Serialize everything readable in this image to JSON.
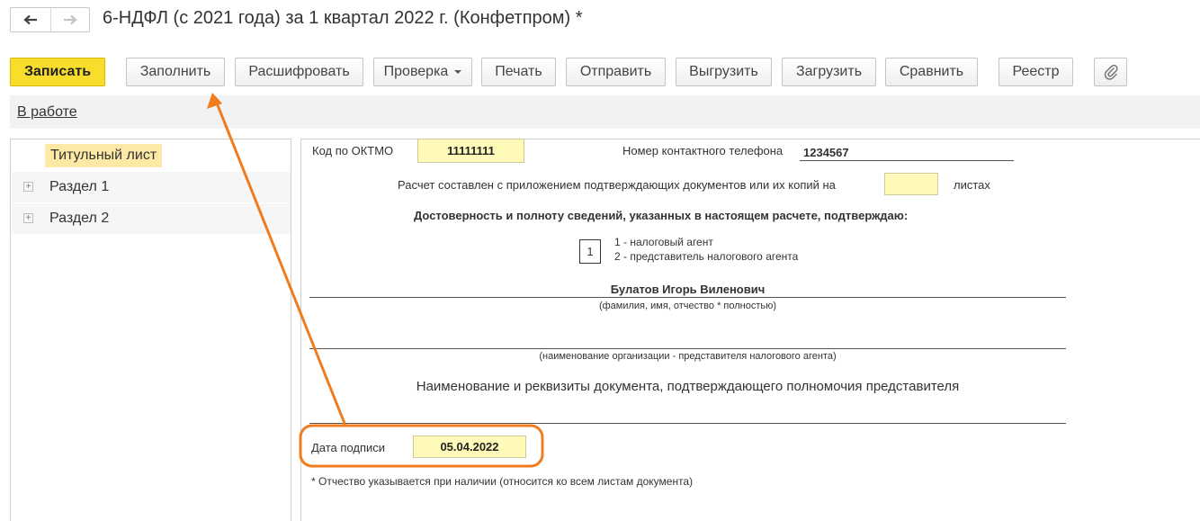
{
  "window": {
    "title": "6-НДФЛ (с 2021 года) за 1 квартал 2022 г. (Конфетпром) *"
  },
  "nav": {
    "back_icon": "arrow-left-icon",
    "forward_icon": "arrow-right-icon"
  },
  "toolbar": {
    "save": "Записать",
    "fill": "Заполнить",
    "decode": "Расшифровать",
    "check": "Проверка",
    "print": "Печать",
    "send": "Отправить",
    "export": "Выгрузить",
    "import": "Загрузить",
    "compare": "Сравнить",
    "registry": "Реестр",
    "attach_icon": "paperclip-icon"
  },
  "status": {
    "label": "В работе"
  },
  "tree": {
    "items": [
      {
        "label": "Титульный лист",
        "selected": true
      },
      {
        "label": "Раздел 1",
        "expandable": true
      },
      {
        "label": "Раздел 2",
        "expandable": true
      }
    ]
  },
  "form": {
    "oktmo_label": "Код по ОКТМО",
    "oktmo_value": "11111111",
    "phone_label": "Номер контактного телефона",
    "phone_value": "1234567",
    "attached_prefix": "Расчет составлен с приложением подтверждающих документов или их копий на",
    "attached_value": "",
    "attached_suffix": "листах",
    "confirm_heading": "Достоверность и полноту сведений, указанных в настоящем расчете, подтверждаю:",
    "signer_code": "1",
    "signer_option_1": "1 - налоговый агент",
    "signer_option_2": "2 - представитель налогового агента",
    "signer_name": "Булатов Игорь Виленович",
    "signer_name_hint": "(фамилия, имя, отчество * полностью)",
    "org_name_value": "",
    "org_name_hint": "(наименование организации - представителя налогового агента)",
    "document_heading": "Наименование и реквизиты документа, подтверждающего полномочия представителя",
    "document_value": "",
    "sign_date_label": "Дата подписи",
    "sign_date_value": "05.04.2022",
    "footnote": "* Отчество указывается при наличии (относится ко всем листам документа)"
  },
  "annotation": {
    "color": "#f07c1e"
  },
  "colors": {
    "primary_button": "#f8dd2b",
    "field_highlight": "#fffab8",
    "selection": "#fbe9a5"
  }
}
